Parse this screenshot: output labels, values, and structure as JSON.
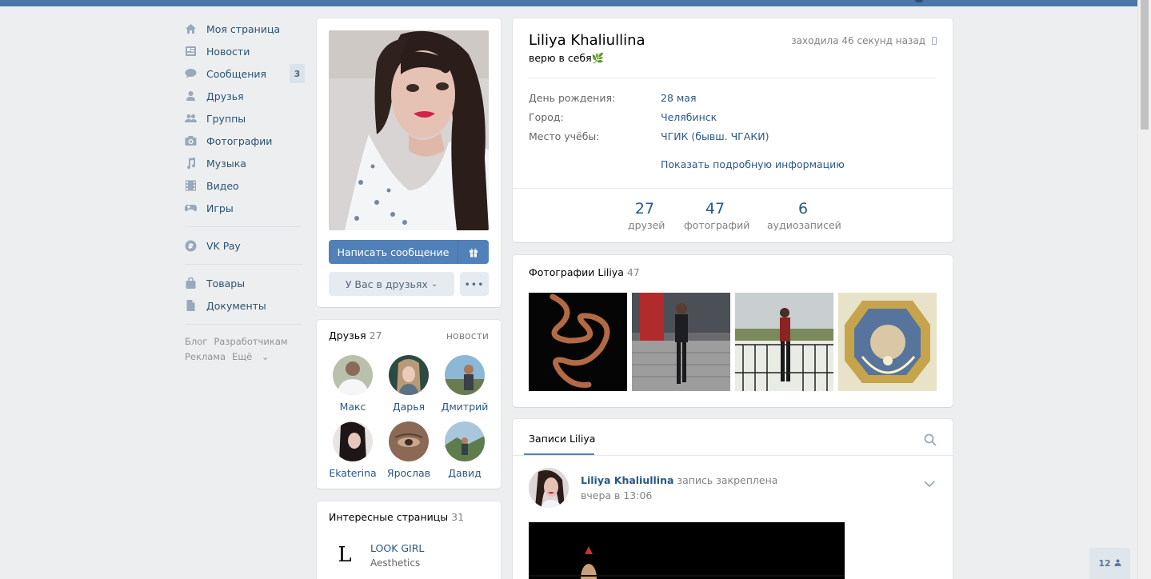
{
  "colors": {
    "accent": "#5181b8",
    "link": "#2a5885",
    "topbar": "#4a76a8",
    "bg": "#edeef0"
  },
  "nav": {
    "items": [
      {
        "label": "Моя страница",
        "icon": "home-icon"
      },
      {
        "label": "Новости",
        "icon": "news-icon"
      },
      {
        "label": "Сообщения",
        "icon": "messages-icon",
        "badge": "3"
      },
      {
        "label": "Друзья",
        "icon": "friend-icon"
      },
      {
        "label": "Группы",
        "icon": "groups-icon"
      },
      {
        "label": "Фотографии",
        "icon": "camera-icon"
      },
      {
        "label": "Музыка",
        "icon": "music-icon"
      },
      {
        "label": "Видео",
        "icon": "video-icon"
      },
      {
        "label": "Игры",
        "icon": "gamepad-icon"
      }
    ],
    "vkpay": "VK Pay",
    "items2": [
      {
        "label": "Товары",
        "icon": "bag-icon"
      },
      {
        "label": "Документы",
        "icon": "document-icon"
      }
    ],
    "footer": {
      "blog": "Блог",
      "dev": "Разработчикам",
      "ads": "Реклама",
      "more": "Ещё"
    }
  },
  "avatar": {
    "send_message": "Написать сообщение",
    "friends_status": "У Вас в друзьях",
    "more": "•••"
  },
  "friends": {
    "title": "Друзья",
    "count": "27",
    "link": "новости",
    "list": [
      "Макс",
      "Дарья",
      "Дмитрий",
      "Ekaterina",
      "Ярослав",
      "Давид"
    ]
  },
  "pages": {
    "title": "Интересные страницы",
    "count": "31",
    "item": {
      "logo": "L",
      "name": "LOOK GIRL",
      "desc": "Aesthetics"
    }
  },
  "profile": {
    "name": "Liliya Khaliullina",
    "status": "верю в себя🌿",
    "online": "заходила 46 секунд назад",
    "rows": [
      {
        "label": "День рождения:",
        "value": "28 мая"
      },
      {
        "label": "Город:",
        "value": "Челябинск"
      },
      {
        "label": "Место учёбы:",
        "value": "ЧГИК (бывш. ЧГАКИ)"
      }
    ],
    "more_info": "Показать подробную информацию",
    "counters": [
      {
        "n": "27",
        "l": "друзей"
      },
      {
        "n": "47",
        "l": "фотографий"
      },
      {
        "n": "6",
        "l": "аудиозаписей"
      }
    ]
  },
  "photos": {
    "title": "Фотографии Liliya",
    "count": "47"
  },
  "wall": {
    "tab": "Записи Liliya",
    "author": "Liliya Khaliullina",
    "pinned": "запись закреплена",
    "time": "вчера в 13:06"
  },
  "mini_chat": {
    "count": "12"
  }
}
